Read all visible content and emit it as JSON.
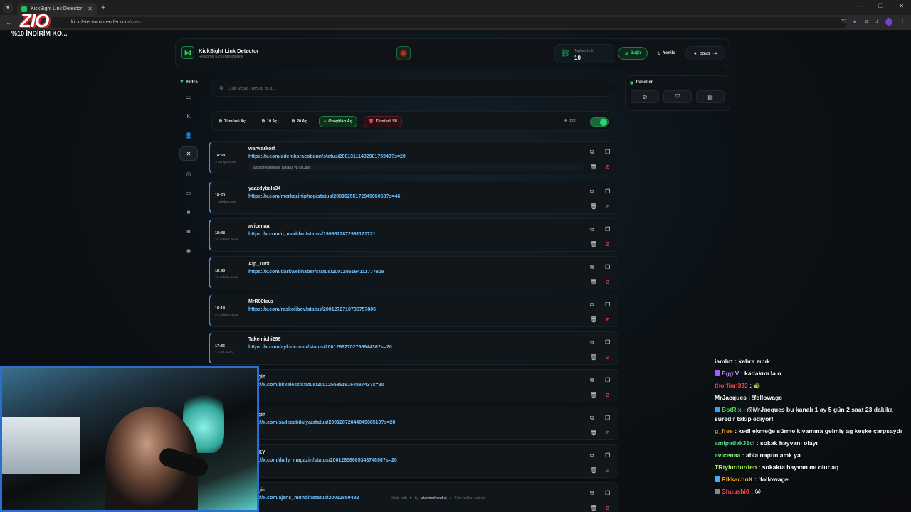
{
  "browser": {
    "tab_title": "KickSight Link Detector",
    "url_host": "kickdetector.onrender.com",
    "url_path": "/cavs"
  },
  "overlay": {
    "logo": "ZIO",
    "promo": "%10 İNDİRİM KO..."
  },
  "header": {
    "title": "KickSight Link Detector",
    "subtitle": "Realtime Kick Intelligence",
    "total_label": "Toplam Link",
    "total_value": "10",
    "connected_label": "Bağlı",
    "refresh_label": "Yenile",
    "user_name": "cavs"
  },
  "sidebar": {
    "filter_label": "Filtre",
    "items": [
      {
        "icon": "list-icon"
      },
      {
        "icon": "kick-icon"
      },
      {
        "icon": "users-icon"
      },
      {
        "icon": "x-icon",
        "active": true
      },
      {
        "icon": "instagram-icon"
      },
      {
        "icon": "youtube-icon"
      },
      {
        "icon": "video-icon"
      },
      {
        "icon": "camera-icon"
      },
      {
        "icon": "globe-icon"
      }
    ]
  },
  "search": {
    "placeholder": "Link veya mesaj ara..."
  },
  "actions": {
    "open_all": "Tümünü Aç",
    "open_10": "10 Aç",
    "open_20": "20 Aç",
    "open_approved": "Onaylıları Aç",
    "delete_all": "Tümünü Sil",
    "bot_label": "Bot",
    "bot_enabled": true
  },
  "links": [
    {
      "time": "18:58",
      "ago": "3 saniye önce",
      "user": "warwarkort",
      "url": "https://x.com/ademkaracobann/status/2001311143290175940?s=20",
      "message": "ezikliğe köpekliğe patlarız ya @Cavs"
    },
    {
      "time": "18:50",
      "ago": "7 dakika önce",
      "user": "yaazdybala34",
      "url": "https://x.com/merkezihiphop/status/2001025517294965058?s=46",
      "message": ""
    },
    {
      "time": "18:48",
      "ago": "10 dakika önce",
      "user": "avicenaa",
      "url": "https://x.com/u_maddxd/status/1999822872991121721",
      "message": ""
    },
    {
      "time": "18:43",
      "ago": "15 dakika önce",
      "user": "Alp_Turk",
      "url": "https://x.com/darkwebhaber/status/2001295164111777809",
      "message": ""
    },
    {
      "time": "18:14",
      "ago": "44 dakika önce",
      "user": "MrR00tsuz",
      "url": "https://x.com/raskolibov/status/2001272710735757805",
      "message": ""
    },
    {
      "time": "17:35",
      "ago": "1 saat önce",
      "user": "Takemichi299",
      "url": "https://x.com/aykiricomtr/status/2001299270276694436?s=20",
      "message": ""
    },
    {
      "time": "",
      "ago": "",
      "user": "...ztigin",
      "url": "...ps://x.com/bkkeless/status/2001265851916488743?s=20",
      "message": ""
    },
    {
      "time": "",
      "ago": "",
      "user": "...ztigin",
      "url": "...ps://x.com/sadecebilalya/status/2001287204404908519?s=20",
      "message": ""
    },
    {
      "time": "",
      "ago": "",
      "user": "...anKY",
      "url": "...ps://x.com/daily_magazin/status/2001265868534374898?s=20",
      "message": ""
    },
    {
      "time": "",
      "ago": "",
      "user": "...ztigin",
      "url": "...ps://x.com/ajans_muhbir/status/20012850482",
      "message": ""
    }
  ],
  "panels": {
    "title": "Paneller",
    "buttons": [
      {
        "icon": "block-icon"
      },
      {
        "icon": "shield-icon"
      },
      {
        "icon": "archive-icon"
      }
    ]
  },
  "footer": {
    "made_with": "Made with",
    "by": "by",
    "author": "atarimuhendisi",
    "rights": "Tüm hakları saklıdır"
  },
  "chat": [
    {
      "user": "iamhtt",
      "color": "#ffffff",
      "text": ": kehra zınık"
    },
    {
      "user": "EgglV",
      "color": "#c58cff",
      "text": ": kadakmı la o",
      "badge": "#a05cff"
    },
    {
      "user": "thorfinn333",
      "color": "#ff4a4a",
      "text": ": 🐢"
    },
    {
      "user": "MrJacques",
      "color": "#ffffff",
      "text": ": !followage"
    },
    {
      "user": "BotRix",
      "color": "#53d65a",
      "text": ": @MrJacques bu kanalı 1 ay 5 gün 2 saat 23 dakika süredir takip ediyor!",
      "badge": "#3aa0ff"
    },
    {
      "user": "g_free",
      "color": "#ff9f1c",
      "text": ": kedi ekmeğe sürme kıvamına gelmiş ag keşke çarpsaydı"
    },
    {
      "user": "amipatlak31ci",
      "color": "#5bd68c",
      "text": ": sokak hayvanı olayı"
    },
    {
      "user": "avicenaa",
      "color": "#7dfc7d",
      "text": ": abla naptın amk ya"
    },
    {
      "user": "TRtylurdurden",
      "color": "#a6f45c",
      "text": ": sokakta hayvan mı olur aq"
    },
    {
      "user": "PikkachuX",
      "color": "#ffb000",
      "text": ": !followage",
      "badge": "#3ab0ff"
    },
    {
      "user": "Shuushi0",
      "color": "#ff4a4a",
      "text": ": 😮",
      "badge": "#888888"
    }
  ]
}
